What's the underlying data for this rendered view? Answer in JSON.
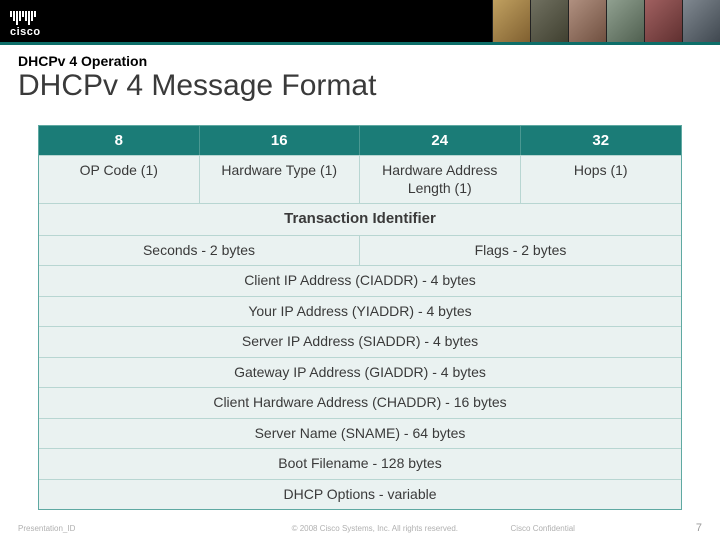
{
  "logo_text": "cisco",
  "eyebrow": "DHCPv 4 Operation",
  "title": "DHCPv 4 Message Format",
  "headers": {
    "c1": "8",
    "c2": "16",
    "c3": "24",
    "c4": "32"
  },
  "row1": {
    "c1": "OP Code (1)",
    "c2": "Hardware Type (1)",
    "c3": "Hardware Address Length (1)",
    "c4": "Hops (1)"
  },
  "row2": "Transaction Identifier",
  "row3": {
    "c1": "Seconds - 2 bytes",
    "c2": "Flags - 2 bytes"
  },
  "row4": "Client IP Address (CIADDR) - 4 bytes",
  "row5": "Your IP Address (YIADDR) - 4 bytes",
  "row6": "Server IP Address (SIADDR) - 4 bytes",
  "row7": "Gateway IP Address (GIADDR) - 4 bytes",
  "row8": "Client Hardware Address (CHADDR) - 16 bytes",
  "row9": "Server Name (SNAME) - 64 bytes",
  "row10": "Boot Filename - 128 bytes",
  "row11": "DHCP Options - variable",
  "footer": {
    "pid": "Presentation_ID",
    "copyright": "© 2008 Cisco Systems, Inc. All rights reserved.",
    "confidential": "Cisco Confidential",
    "page": "7"
  }
}
